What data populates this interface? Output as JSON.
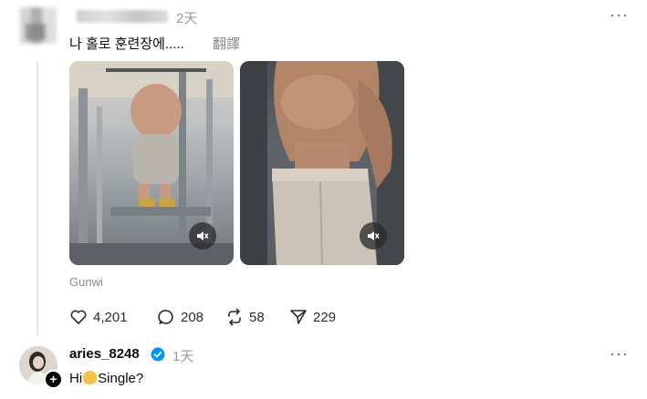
{
  "post": {
    "time": "2天",
    "text": "나 홀로 훈련장에.....",
    "translate": "翻譯",
    "more": "···",
    "source": "Gunwi",
    "stats": {
      "likes": "4,201",
      "comments": "208",
      "reposts": "58",
      "shares": "229"
    }
  },
  "reply": {
    "username": "aries_8248",
    "time": "1天",
    "text_before": "Hi",
    "text_after": "Single?",
    "more": "···",
    "follow_plus": "+"
  },
  "colors": {
    "muted": "#9a9a9a",
    "verified": "#0095f6"
  }
}
